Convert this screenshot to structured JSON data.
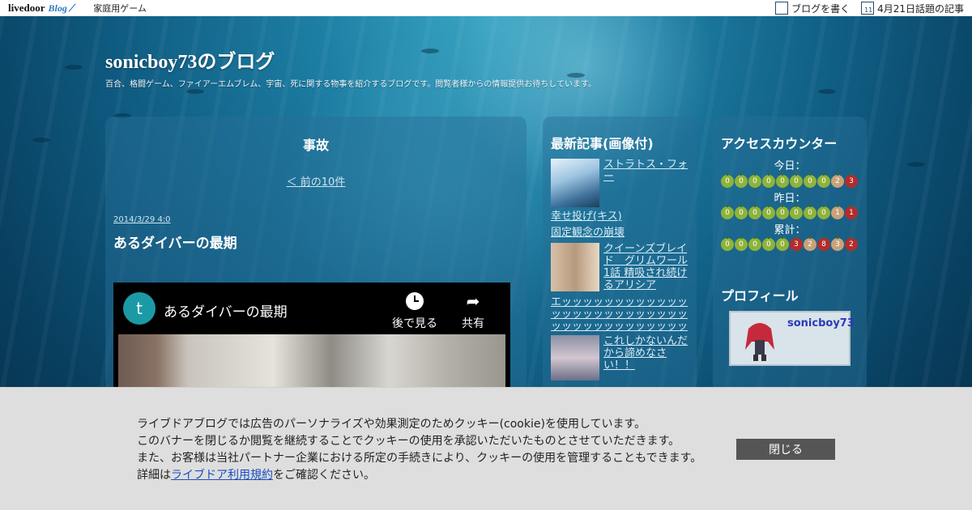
{
  "topbar": {
    "logo_livedoor": "livedoor",
    "logo_blog": "Blog",
    "category": "家庭用ゲーム",
    "write_blog": "ブログを書く",
    "trending": "4月21日話題の記事",
    "calendar_day": "11"
  },
  "header": {
    "title": "sonicboy73のブログ",
    "description": "百合、格闘ゲーム、ファイアーエムブレム、宇宙、死に関する物事を紹介するブログです。閲覧者様からの情報提供お待ちしています。"
  },
  "main": {
    "category_title": "事故",
    "prev_link": "＜ 前の10件",
    "post": {
      "date": "2014/3/29 4:0",
      "title": "あるダイバーの最期"
    },
    "video": {
      "avatar_letter": "t",
      "title": "あるダイバーの最期",
      "watch_later": "後で見る",
      "share": "共有"
    }
  },
  "recent": {
    "title": "最新記事(画像付)",
    "articles": [
      {
        "title": "ストラトス・フォー"
      },
      {
        "title": "幸せ投げ(キス)"
      },
      {
        "title": "固定観念の崩壊"
      },
      {
        "title": "クイーンズブレイド　グリムワール1話 精吸され続けるアリシア"
      },
      {
        "title": "エッッッッッッッッッッッッッッッッッッッッッッッッッッッッッッッッッッッッッッッ"
      },
      {
        "title": "これしかないんだから諦めなさい！！"
      }
    ]
  },
  "counter": {
    "title": "アクセスカウンター",
    "today_label": "今日：",
    "yesterday_label": "昨日：",
    "total_label": "累計：",
    "today_digits": [
      "0",
      "0",
      "0",
      "0",
      "0",
      "0",
      "0",
      "0",
      "2",
      "3"
    ],
    "yesterday_digits": [
      "0",
      "0",
      "0",
      "0",
      "0",
      "0",
      "0",
      "0",
      "1",
      "1"
    ],
    "total_digits": [
      "0",
      "0",
      "0",
      "0",
      "0",
      "3",
      "2",
      "8",
      "3",
      "2"
    ]
  },
  "profile": {
    "title": "プロフィール",
    "name": "sonicboy73"
  },
  "cookie": {
    "line1": "ライブドアブログでは広告のパーソナライズや効果測定のためクッキー(cookie)を使用しています。",
    "line2": "このバナーを閉じるか閲覧を継続することでクッキーの使用を承認いただいたものとさせていただきます。",
    "line3": "また、お客様は当社パートナー企業における所定の手続きにより、クッキーの使用を管理することもできます。",
    "line4_prefix": "詳細は",
    "line4_link": "ライブドア利用規約",
    "line4_suffix": "をご確認ください。",
    "close": "閉じる"
  },
  "colors": {
    "digit_green": "#8fb33a",
    "digit_red": "#b32c2c",
    "digit_tan": "#c7a27a",
    "close_button": "#555555",
    "link_blue": "#1a4ec2"
  }
}
